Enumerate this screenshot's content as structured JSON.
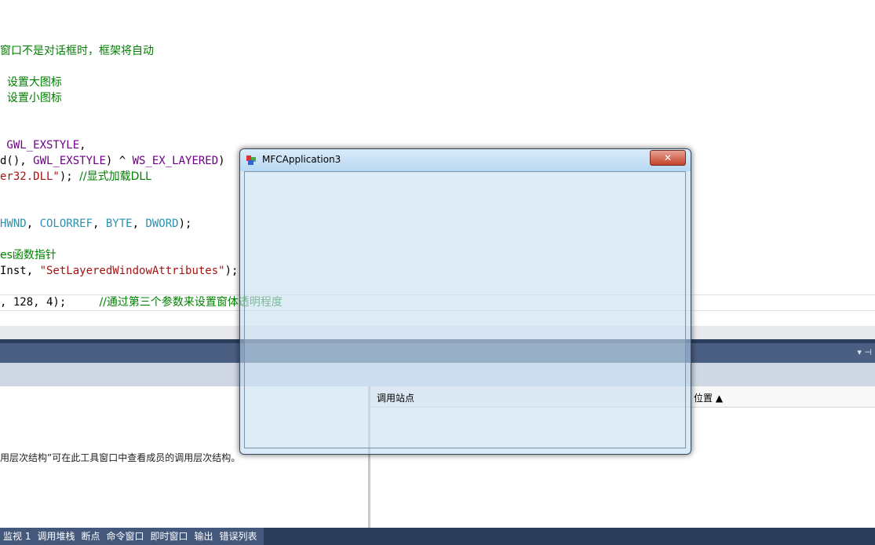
{
  "code_lines": [
    {
      "parts": [
        {
          "c": "cmt",
          "t": "窗口不是对话框时，框架将自动"
        }
      ]
    },
    {
      "parts": [
        {
          "c": "cmt",
          "t": "  设置大图标"
        }
      ]
    },
    {
      "parts": [
        {
          "c": "cmt",
          "t": "  设置小图标"
        }
      ]
    },
    {
      "parts": [
        {
          "c": "mac",
          "t": " GWL_EXSTYLE"
        },
        {
          "c": "pl",
          "t": ","
        }
      ]
    },
    {
      "parts": [
        {
          "c": "pl",
          "t": "d(), "
        },
        {
          "c": "mac",
          "t": "GWL_EXSTYLE"
        },
        {
          "c": "pl",
          "t": ") ^ "
        },
        {
          "c": "mac",
          "t": "WS_EX_LAYERED"
        },
        {
          "c": "pl",
          "t": ")"
        }
      ]
    },
    {
      "parts": [
        {
          "c": "str",
          "t": "er32.DLL\""
        },
        {
          "c": "pl",
          "t": "); "
        },
        {
          "c": "cmt",
          "t": "//显式加载DLL"
        }
      ]
    },
    {
      "parts": [
        {
          "c": "typ",
          "t": "HWND"
        },
        {
          "c": "pl",
          "t": ", "
        },
        {
          "c": "typ",
          "t": "COLORREF"
        },
        {
          "c": "pl",
          "t": ", "
        },
        {
          "c": "typ",
          "t": "BYTE"
        },
        {
          "c": "pl",
          "t": ", "
        },
        {
          "c": "typ",
          "t": "DWORD"
        },
        {
          "c": "pl",
          "t": ");"
        }
      ]
    },
    {
      "parts": [
        {
          "c": "cmt",
          "t": "es函数指针"
        }
      ]
    },
    {
      "parts": [
        {
          "c": "pl",
          "t": "Inst, "
        },
        {
          "c": "str",
          "t": "\"SetLayeredWindowAttributes\""
        },
        {
          "c": "pl",
          "t": ");"
        }
      ]
    },
    {
      "parts": [
        {
          "c": "pl",
          "t": ", 128, 4);     "
        },
        {
          "c": "cmt",
          "t": "//通过第三个参数来设置窗体透明程度"
        }
      ]
    }
  ],
  "panel": {
    "columns": [
      "调用站点",
      "位置 ▲"
    ],
    "message": "用层次结构”可在此工具窗口中查看成员的调用层次结构。",
    "title_buttons": "▾ ⊣"
  },
  "bottom_tabs": [
    "监视 1",
    "调用堆栈",
    "断点",
    "命令窗口",
    "即时窗口",
    "输出",
    "错误列表"
  ],
  "dialog": {
    "title": "MFCApplication3",
    "close": "✕"
  }
}
